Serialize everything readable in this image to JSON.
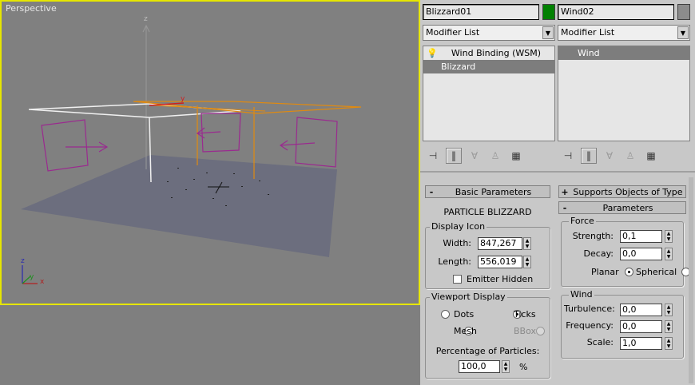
{
  "viewport": {
    "label": "Perspective",
    "axis_labels": {
      "z": "z",
      "y": "y",
      "x": "x"
    },
    "gizmo_label": "y",
    "border_color": "#e6e600"
  },
  "left_column": {
    "object_name": "Blizzard01",
    "object_color": "#008000",
    "modifier_list": "Modifier List",
    "stack": [
      {
        "label": "Wind Binding (WSM)",
        "icon": "lightbulb-icon",
        "selected": false
      },
      {
        "label": "Blizzard",
        "selected": true
      }
    ]
  },
  "right_column": {
    "object_name": "Wind02",
    "object_color": "#8c8c8c",
    "modifier_list": "Modifier List",
    "stack": [
      {
        "label": "Wind",
        "selected": true
      }
    ]
  },
  "toolbar_icons": [
    "pin-stack-icon",
    "show-end-result-icon",
    "make-unique-icon",
    "remove-modifier-icon",
    "configure-sets-icon"
  ],
  "basic_parameters": {
    "rollout_title": "Basic Parameters",
    "sign": "-",
    "heading": "PARTICLE BLIZZARD",
    "display_icon": {
      "legend": "Display Icon",
      "width_label": "Width:",
      "width_value": "847,267",
      "length_label": "Length:",
      "length_value": "556,019",
      "emitter_hidden_label": "Emitter Hidden",
      "emitter_hidden": false
    },
    "viewport_display": {
      "legend": "Viewport Display",
      "options": [
        {
          "label": "Dots",
          "selected": false,
          "enabled": true
        },
        {
          "label": "Ticks",
          "selected": true,
          "enabled": true
        },
        {
          "label": "Mesh",
          "selected": false,
          "enabled": true
        },
        {
          "label": "BBox",
          "selected": false,
          "enabled": false
        }
      ],
      "percentage_label": "Percentage of Particles:",
      "percentage_value": "100,0",
      "percent_sign": "%"
    }
  },
  "supports_rollout": {
    "sign": "+",
    "title": "Supports Objects of Type"
  },
  "wind_parameters": {
    "rollout_title": "Parameters",
    "sign": "-",
    "force": {
      "legend": "Force",
      "strength_label": "Strength:",
      "strength_value": "0,1",
      "decay_label": "Decay:",
      "decay_value": "0,0",
      "planar_label": "Planar",
      "spherical_label": "Spherical",
      "mode": "Planar"
    },
    "wind": {
      "legend": "Wind",
      "turbulence_label": "Turbulence:",
      "turbulence_value": "0,0",
      "frequency_label": "Frequency:",
      "frequency_value": "0,0",
      "scale_label": "Scale:",
      "scale_value": "1,0"
    }
  }
}
